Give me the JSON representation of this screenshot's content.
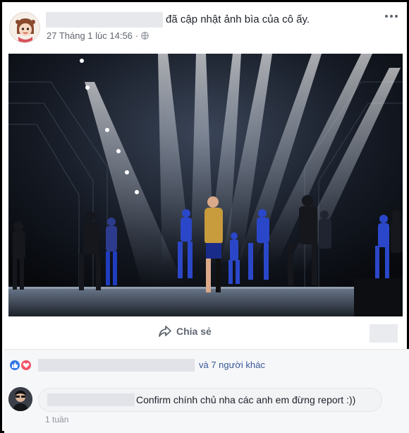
{
  "post": {
    "headline": "đã cập nhật ảnh bìa của cô ấy.",
    "timestamp": "27 Tháng 1 lúc 14:56",
    "separator": "·",
    "privacy_icon": "globe-icon",
    "more_icon": "more-horizontal-icon"
  },
  "cover": {
    "icon": "stage-photo"
  },
  "actions": {
    "share_label": "Chia sẻ",
    "share_icon": "share-arrow-icon"
  },
  "reactions": {
    "icons": [
      "like-icon",
      "love-icon"
    ],
    "others_text": "và 7 người khác",
    "like_color": "#3578e5",
    "love_color": "#f25268"
  },
  "comment": {
    "text": "Confirm chính chủ nha các anh em đừng report :))",
    "time": "1 tuần"
  },
  "colors": {
    "link": "#385898",
    "meta": "#616770",
    "background": "#f6f7f9"
  }
}
